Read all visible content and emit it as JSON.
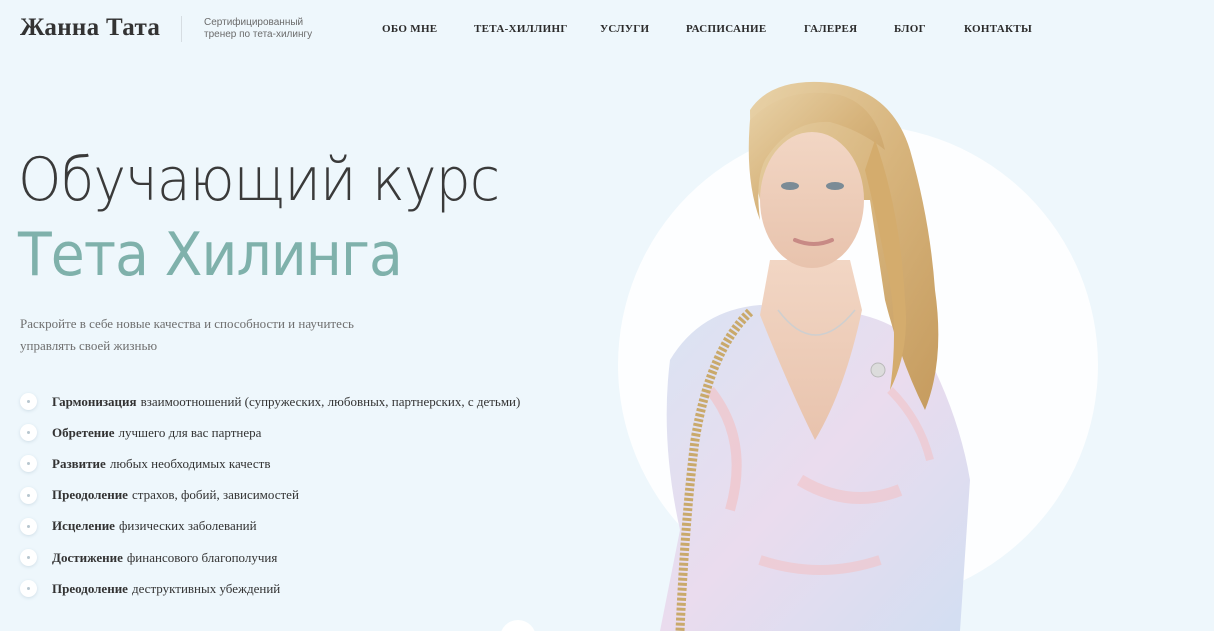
{
  "header": {
    "logo": "Жанна Тата",
    "tagline": "Сертифицированный тренер по тета-хилингу",
    "nav": [
      {
        "label": "ОБО МНЕ"
      },
      {
        "label": "ТЕТА-ХИЛЛИНГ"
      },
      {
        "label": "УСЛУГИ"
      },
      {
        "label": "РАСПИСАНИЕ"
      },
      {
        "label": "ГАЛЕРЕЯ"
      },
      {
        "label": "БЛОГ"
      },
      {
        "label": "КОНТАКТЫ"
      }
    ]
  },
  "hero": {
    "title_line1": "Обучающий курс",
    "title_line2": "Тета Хилинга",
    "description": "Раскройте в себе новые качества и способности и научитесь управлять своей жизнью",
    "features": [
      {
        "bold": "Гармонизация",
        "text": "взаимоотношений (супружеских, любовных, партнерских, с детьми)"
      },
      {
        "bold": "Обретение",
        "text": "лучшего для вас партнера"
      },
      {
        "bold": "Развитие",
        "text": "любых необходимых качеств"
      },
      {
        "bold": "Преодоление",
        "text": "страхов, фобий, зависимостей"
      },
      {
        "bold": "Исцеление",
        "text": "физических заболеваний"
      },
      {
        "bold": "Достижение",
        "text": "финансового благополучия"
      },
      {
        "bold": "Преодоление",
        "text": "деструктивных убеждений"
      }
    ]
  },
  "colors": {
    "background": "#eef7fc",
    "accent": "#7fb1ab",
    "text": "#333333"
  }
}
